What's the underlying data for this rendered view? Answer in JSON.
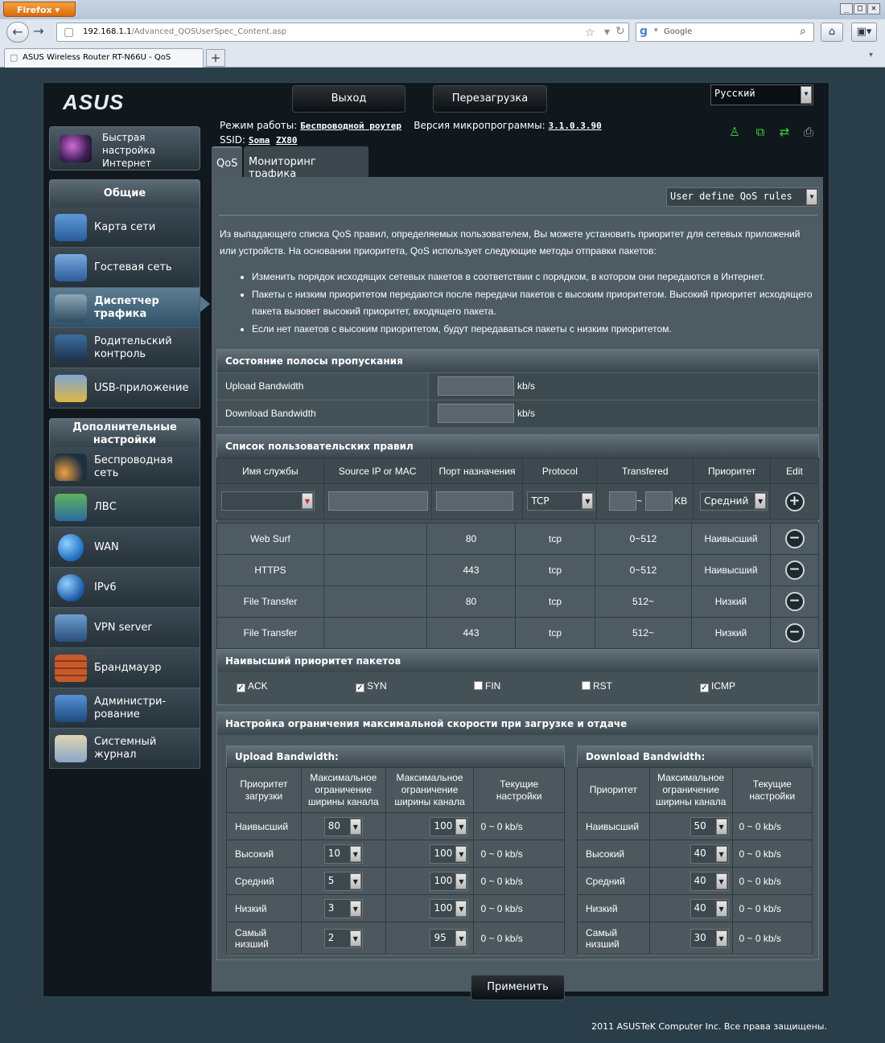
{
  "browser": {
    "menu_label": "Firefox",
    "url_host": "192.168.1.1",
    "url_path": "/Advanced_QOSUserSpec_Content.asp",
    "search_placeholder": "Google",
    "tab_title": "ASUS Wireless Router RT-N66U - QoS",
    "new_tab": "+",
    "win_min": "_",
    "win_max": "□",
    "win_close": "✕"
  },
  "header": {
    "logo": "ASUS",
    "logout_label": "Выход",
    "reboot_label": "Перезагрузка",
    "language": "Русский"
  },
  "info": {
    "mode_label": "Режим работы:",
    "mode_value": "Беспроводной роутер",
    "firmware_label": "Версия микропрограммы:",
    "firmware_value": "3.1.0.3.90",
    "ssid_label": "SSID:",
    "ssid_1": "Soma",
    "ssid_2": "ZX80"
  },
  "sidebar": {
    "qis_l1": "Быстрая",
    "qis_l2": "настройка",
    "qis_l3": "Интернет",
    "general_header": "Общие",
    "general_items": [
      {
        "l1": "Карта сети",
        "l2": ""
      },
      {
        "l1": "Гостевая сеть",
        "l2": ""
      },
      {
        "l1": "Диспетчер",
        "l2": "трафика"
      },
      {
        "l1": "Родительский",
        "l2": "контроль"
      },
      {
        "l1": "USB-приложение",
        "l2": ""
      }
    ],
    "advanced_header_l1": "Дополнительные",
    "advanced_header_l2": "настройки",
    "advanced_items": [
      {
        "l1": "Беспроводная",
        "l2": "сеть"
      },
      {
        "l1": "ЛВС",
        "l2": ""
      },
      {
        "l1": "WAN",
        "l2": ""
      },
      {
        "l1": "IPv6",
        "l2": ""
      },
      {
        "l1": "VPN server",
        "l2": ""
      },
      {
        "l1": "Брандмауэр",
        "l2": ""
      },
      {
        "l1": "Администри-",
        "l2": "рование"
      },
      {
        "l1": "Системный",
        "l2": "журнал"
      }
    ]
  },
  "tabs": {
    "qos": "QoS",
    "monitor": "Мониторинг трафика"
  },
  "content": {
    "qos_mode": "User define QoS rules",
    "intro": "Из выпадающего списка QoS правил, определяемых пользователем, Вы можете установить приоритет для сетевых приложений или устройств. На основании приоритета, QoS использует следующие методы отправки пакетов:",
    "bullets": [
      "Изменить порядок исходящих сетевых пакетов в соответствии с порядком, в котором они передаются в Интернет.",
      "Пакеты с низким приоритетом передаются после передачи пакетов с высоким приоритетом. Высокий приоритет исходящего пакета вызовет высокий приоритет, входящего пакета.",
      "Если нет пакетов с высоким приоритетом, будут передаваться пакеты с низким приоритетом."
    ]
  },
  "bandwidth_status": {
    "title": "Состояние полосы пропускания",
    "upload_label": "Upload Bandwidth",
    "download_label": "Download Bandwidth",
    "unit": "kb/s",
    "upload_value": "",
    "download_value": ""
  },
  "rules": {
    "title": "Список пользовательских правил",
    "columns": [
      "Имя службы",
      "Source IP or MAC",
      "Порт назначения",
      "Protocol",
      "Transfered",
      "Приоритет",
      "Edit"
    ],
    "new_protocol": "TCP",
    "new_transfer_sep": "~",
    "new_transfer_unit": "KB",
    "new_priority": "Средний",
    "add_symbol": "+",
    "del_symbol": "−",
    "rows": [
      {
        "name": "Web Surf",
        "src": "",
        "port": "80",
        "proto": "tcp",
        "transfer": "0~512",
        "priority": "Наивысший"
      },
      {
        "name": "HTTPS",
        "src": "",
        "port": "443",
        "proto": "tcp",
        "transfer": "0~512",
        "priority": "Наивысший"
      },
      {
        "name": "File Transfer",
        "src": "",
        "port": "80",
        "proto": "tcp",
        "transfer": "512~",
        "priority": "Низкий"
      },
      {
        "name": "File Transfer",
        "src": "",
        "port": "443",
        "proto": "tcp",
        "transfer": "512~",
        "priority": "Низкий"
      }
    ]
  },
  "packets": {
    "title": "Наивысший приоритет пакетов",
    "items": [
      {
        "label": "ACK",
        "checked": "✓"
      },
      {
        "label": "SYN",
        "checked": "✓"
      },
      {
        "label": "FIN",
        "checked": ""
      },
      {
        "label": "RST",
        "checked": ""
      },
      {
        "label": "ICMP",
        "checked": "✓"
      }
    ]
  },
  "limits": {
    "title": "Настройка ограничения максимальной скорости при загрузке и отдаче",
    "upload": {
      "title": "Upload Bandwidth:",
      "h_priority_l1": "Приоритет",
      "h_priority_l2": "загрузки",
      "h_max_l1": "Максимальное",
      "h_max_l2": "ограничение",
      "h_max_l3": "ширины канала",
      "h_cur_l1": "Текущие",
      "h_cur_l2": "настройки",
      "rows": [
        {
          "p1": "Наивысший",
          "p2": "",
          "min": "80",
          "max": "100",
          "cur": "0 ~ 0 kb/s"
        },
        {
          "p1": "Высокий",
          "p2": "",
          "min": "10",
          "max": "100",
          "cur": "0 ~ 0 kb/s"
        },
        {
          "p1": "Средний",
          "p2": "",
          "min": "5",
          "max": "100",
          "cur": "0 ~ 0 kb/s"
        },
        {
          "p1": "Низкий",
          "p2": "",
          "min": "3",
          "max": "100",
          "cur": "0 ~ 0 kb/s"
        },
        {
          "p1": "Самый",
          "p2": "низший",
          "min": "2",
          "max": "95",
          "cur": "0 ~ 0 kb/s"
        }
      ]
    },
    "download": {
      "title": "Download Bandwidth:",
      "h_priority": "Приоритет",
      "rows": [
        {
          "p1": "Наивысший",
          "p2": "",
          "val": "50",
          "cur": "0 ~ 0 kb/s"
        },
        {
          "p1": "Высокий",
          "p2": "",
          "val": "40",
          "cur": "0 ~ 0 kb/s"
        },
        {
          "p1": "Средний",
          "p2": "",
          "val": "40",
          "cur": "0 ~ 0 kb/s"
        },
        {
          "p1": "Низкий",
          "p2": "",
          "val": "40",
          "cur": "0 ~ 0 kb/s"
        },
        {
          "p1": "Самый",
          "p2": "низший",
          "val": "30",
          "cur": "0 ~ 0 kb/s"
        }
      ]
    }
  },
  "apply_label": "Применить",
  "footer": "2011 ASUSTeK Computer Inc. Все права защищены."
}
